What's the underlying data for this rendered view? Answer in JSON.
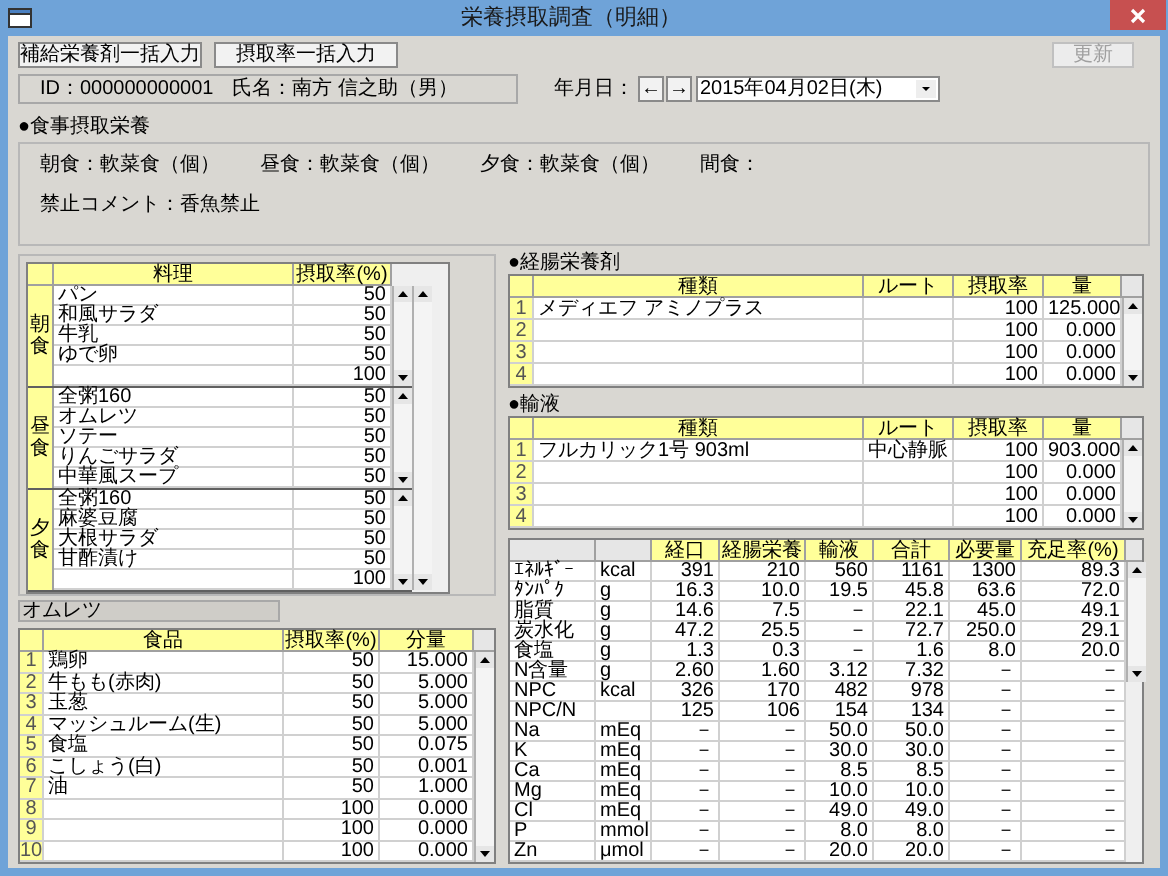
{
  "window": {
    "title": "栄養摂取調査（明細）"
  },
  "toolbar": {
    "buttons": [
      {
        "label": "補給栄養剤一括入力",
        "disabled": false
      },
      {
        "label": "摂取率一括入力",
        "disabled": false
      }
    ],
    "update_button": {
      "label": "更新",
      "disabled": true
    }
  },
  "patient": {
    "id": "ID：000000000001",
    "name": "氏名：南方 信之助（男）"
  },
  "date": {
    "label": "年月日：",
    "prev": "←",
    "next": "→",
    "value": "2015年04月02日(木)"
  },
  "meal_intake": {
    "heading": "●食事摂取栄養",
    "meals": [
      "朝食：軟菜食（個）",
      "昼食：軟菜食（個）",
      "夕食：軟菜食（個）",
      "間食："
    ],
    "comment": "禁止コメント：香魚禁止"
  },
  "meal_table": {
    "columns": [
      "料理",
      "摂取率(%)"
    ],
    "groups": [
      {
        "label": "朝食",
        "rows": [
          {
            "dish": "パン",
            "rate": "50"
          },
          {
            "dish": "和風サラダ",
            "rate": "50"
          },
          {
            "dish": "牛乳",
            "rate": "50"
          },
          {
            "dish": "ゆで卵",
            "rate": "50"
          },
          {
            "rate": "100"
          }
        ]
      },
      {
        "label": "昼食",
        "rows": [
          {
            "dish": "全粥160",
            "rate": "50"
          },
          {
            "dish": "オムレツ",
            "rate": "50"
          },
          {
            "dish": "ソテー",
            "rate": "50"
          },
          {
            "dish": "りんごサラダ",
            "rate": "50"
          },
          {
            "dish": "中華風スープ",
            "rate": "50"
          }
        ]
      },
      {
        "label": "夕食",
        "rows": [
          {
            "dish": "全粥160",
            "rate": "50"
          },
          {
            "dish": "麻婆豆腐",
            "rate": "50"
          },
          {
            "dish": "大根サラダ",
            "rate": "50"
          },
          {
            "dish": "甘酢漬け",
            "rate": "50"
          },
          {
            "rate": "100"
          }
        ]
      }
    ]
  },
  "selected_dish": "オムレツ",
  "food_table": {
    "columns": [
      "食品",
      "摂取率(%)",
      "分量"
    ],
    "rows": [
      {
        "no": "1",
        "name": "鶏卵",
        "rate": "50",
        "amount": "15.000"
      },
      {
        "no": "2",
        "name": "牛もも(赤肉)",
        "rate": "50",
        "amount": "5.000"
      },
      {
        "no": "3",
        "name": "玉葱",
        "rate": "50",
        "amount": "5.000"
      },
      {
        "no": "4",
        "name": "マッシュルーム(生)",
        "rate": "50",
        "amount": "5.000"
      },
      {
        "no": "5",
        "name": "食塩",
        "rate": "50",
        "amount": "0.075"
      },
      {
        "no": "6",
        "name": "こしょう(白)",
        "rate": "50",
        "amount": "0.001"
      },
      {
        "no": "7",
        "name": "油",
        "rate": "50",
        "amount": "1.000"
      },
      {
        "no": "8",
        "rate": "100",
        "amount": "0.000"
      },
      {
        "no": "9",
        "rate": "100",
        "amount": "0.000"
      },
      {
        "no": "10",
        "rate": "100",
        "amount": "0.000"
      }
    ]
  },
  "enteral": {
    "heading": "●経腸栄養剤",
    "columns": [
      "種類",
      "ルート",
      "摂取率",
      "量"
    ],
    "rows": [
      {
        "no": "1",
        "name": "メディエフ アミノプラス",
        "rate": "100",
        "amount": "125.000"
      },
      {
        "no": "2",
        "rate": "100",
        "amount": "0.000"
      },
      {
        "no": "3",
        "rate": "100",
        "amount": "0.000"
      },
      {
        "no": "4",
        "rate": "100",
        "amount": "0.000"
      }
    ]
  },
  "infusion": {
    "heading": "●輸液",
    "columns": [
      "種類",
      "ルート",
      "摂取率",
      "量"
    ],
    "rows": [
      {
        "no": "1",
        "name": "フルカリック1号 903ml",
        "route": "中心静脈",
        "rate": "100",
        "amount": "903.000"
      },
      {
        "no": "2",
        "rate": "100",
        "amount": "0.000"
      },
      {
        "no": "3",
        "rate": "100",
        "amount": "0.000"
      },
      {
        "no": "4",
        "rate": "100",
        "amount": "0.000"
      }
    ]
  },
  "nutrition_table": {
    "columns": [
      "経口",
      "経腸栄養",
      "輸液",
      "合計",
      "必要量",
      "充足率(%)"
    ],
    "rows": [
      {
        "name": "ｴﾈﾙｷﾞｰ",
        "unit": "kcal",
        "values": [
          "391",
          "210",
          "560",
          "1161",
          "1300",
          "89.3"
        ]
      },
      {
        "name": "ﾀﾝﾊﾟｸ",
        "unit": "g",
        "values": [
          "16.3",
          "10.0",
          "19.5",
          "45.8",
          "63.6",
          "72.0"
        ]
      },
      {
        "name": "脂質",
        "unit": "g",
        "values": [
          "14.6",
          "7.5",
          "－",
          "22.1",
          "45.0",
          "49.1"
        ]
      },
      {
        "name": "炭水化",
        "unit": "g",
        "values": [
          "47.2",
          "25.5",
          "－",
          "72.7",
          "250.0",
          "29.1"
        ]
      },
      {
        "name": "食塩",
        "unit": "g",
        "values": [
          "1.3",
          "0.3",
          "－",
          "1.6",
          "8.0",
          "20.0"
        ]
      },
      {
        "name": "N含量",
        "unit": "g",
        "values": [
          "2.60",
          "1.60",
          "3.12",
          "7.32",
          "－",
          "－"
        ]
      },
      {
        "name": "NPC",
        "unit": "kcal",
        "values": [
          "326",
          "170",
          "482",
          "978",
          "－",
          "－"
        ]
      },
      {
        "name": "NPC/N",
        "values": [
          "125",
          "106",
          "154",
          "134",
          "－",
          "－"
        ]
      },
      {
        "name": "Na",
        "unit": "mEq",
        "values": [
          "－",
          "－",
          "50.0",
          "50.0",
          "－",
          "－"
        ]
      },
      {
        "name": "K",
        "unit": "mEq",
        "values": [
          "－",
          "－",
          "30.0",
          "30.0",
          "－",
          "－"
        ]
      },
      {
        "name": "Ca",
        "unit": "mEq",
        "values": [
          "－",
          "－",
          "8.5",
          "8.5",
          "－",
          "－"
        ]
      },
      {
        "name": "Mg",
        "unit": "mEq",
        "values": [
          "－",
          "－",
          "10.0",
          "10.0",
          "－",
          "－"
        ]
      },
      {
        "name": "Cl",
        "unit": "mEq",
        "values": [
          "－",
          "－",
          "49.0",
          "49.0",
          "－",
          "－"
        ]
      },
      {
        "name": "P",
        "unit": "mmol",
        "values": [
          "－",
          "－",
          "8.0",
          "8.0",
          "－",
          "－"
        ]
      },
      {
        "name": "Zn",
        "unit": "μmol",
        "values": [
          "－",
          "－",
          "20.0",
          "20.0",
          "－",
          "－"
        ]
      }
    ]
  }
}
